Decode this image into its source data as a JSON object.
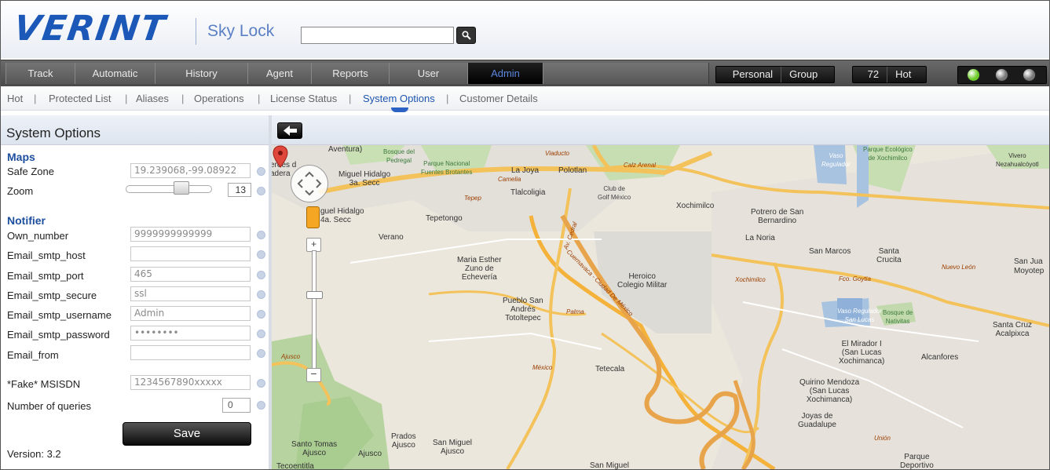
{
  "header": {
    "logo": "VERINT",
    "product": "Sky Lock",
    "search_value": ""
  },
  "nav": {
    "tabs": [
      {
        "label": "Track",
        "active": false
      },
      {
        "label": "Automatic",
        "active": false
      },
      {
        "label": "History",
        "active": false
      },
      {
        "label": "Agent",
        "active": false
      },
      {
        "label": "Reports",
        "active": false
      },
      {
        "label": "User",
        "active": false
      },
      {
        "label": "Admin",
        "active": true
      }
    ],
    "personal": "Personal",
    "group": "Group",
    "count": "72",
    "hot": "Hot",
    "lights": [
      "#6ecb2b",
      "#777777",
      "#777777"
    ]
  },
  "subnav": {
    "items": [
      "Hot",
      "Protected List",
      "Aliases",
      "Operations",
      "License Status",
      "System Options",
      "Customer Details"
    ],
    "active": "System Options"
  },
  "panel": {
    "title": "System Options",
    "maps_section": "Maps",
    "safe_zone_label": "Safe Zone",
    "safe_zone_value": "19.239068,-99.08922",
    "zoom_label": "Zoom",
    "zoom_value": "13",
    "notifier_section": "Notifier",
    "fields": [
      {
        "label": "Own_number",
        "value": "9999999999999"
      },
      {
        "label": "Email_smtp_host",
        "value": ""
      },
      {
        "label": "Email_smtp_port",
        "value": "465"
      },
      {
        "label": "Email_smtp_secure",
        "value": "ssl"
      },
      {
        "label": "Email_smtp_username",
        "value": "Admin"
      },
      {
        "label": "Email_smtp_password",
        "value": "••••••••"
      },
      {
        "label": "Email_from",
        "value": ""
      }
    ],
    "fake_msisdn_label": "*Fake* MSISDN",
    "fake_msisdn_value": "1234567890xxxxx",
    "queries_label": "Number of queries",
    "queries_value": "0",
    "save_label": "Save",
    "version": "Version: 3.2"
  },
  "map": {
    "labels": {
      "aventura": "Aventura)",
      "bosque_pedregal": "Bosque del\nPedregal",
      "parque_nacional": "Parque Nacional\nFuentes Brotantes",
      "viaducto": "Viaducto",
      "calz_arenal": "Calz Arenal",
      "vaso_regulador": "Vaso\nRegulador",
      "parque_ecologico": "Parque Ecológico\nde Xochimilco",
      "vivero": "Vivero\nNezahualcóyotl",
      "heroes": "eroes d\nadera",
      "miguel_hidalgo_3a": "Miguel Hidalgo\n3a. Secc",
      "la_joya": "La Joya",
      "polotlan": "Polotlan",
      "camelia": "Camelia",
      "tlalcoligia": "Tlalcoligia",
      "club_golf": "Club de\nGolf México",
      "xochimilco": "Xochimilco",
      "potrero": "Potrero de San\nBernardino",
      "miguel_hidalgo_4a": "guel Hidalgo\n4a. Secc",
      "tepetongo": "Tepetongo",
      "tepep": "Tepep",
      "verano": "Verano",
      "la_noria": "La Noria",
      "san_marcos": "San Marcos",
      "santa_crucita": "Santa\nCrucita",
      "san_jua": "San Jua",
      "moyotep": "Moyotep",
      "maria_esther": "Maria Esther\nZuno de\nEchevería",
      "heroico": "Heroico\nColegio Militar",
      "xochimilco_road": "Xochimilco",
      "nuevo_leon": "Nuevo León",
      "fco_goytia": "Fco. Goytia",
      "av_cedral": "Av. Cedral",
      "pueblo_san_andres": "Pueblo San\nAndrés\nTotoltepec",
      "palma": "Palma",
      "cuernavaca": "Cuernavaca - Ciudad De México",
      "vaso_regulador2": "Vaso Regulador\nSan Lucas",
      "bosque_nativitas": "Bosque de\nNativitas",
      "santa_cruz": "Santa Cruz\nAcalpixca",
      "el_mirador": "El Mirador I\n(San Lucas\nXochimanca)",
      "alcanfores": "Alcanfores",
      "mexico": "México",
      "tetecala": "Tetecala",
      "quirino": "Quirino Mendoza\n(San Lucas\nXochimanca)",
      "joyas": "Joyas de\nGuadalupe",
      "union": "Unión",
      "ajusco_road": "Ajusco",
      "prados_ajusco": "Prados\nAjusco",
      "san_miguel_ajusco": "San Miguel\nAjusco",
      "santo_tomas": "Santo Tomas\nAjusco",
      "ajusco": "Ajusco",
      "tecoentitla": "Tecoentitla",
      "san_miguel": "San Miguel",
      "parque_deportivo": "Parque\nDeportivo",
      "shield_95": "95"
    }
  }
}
